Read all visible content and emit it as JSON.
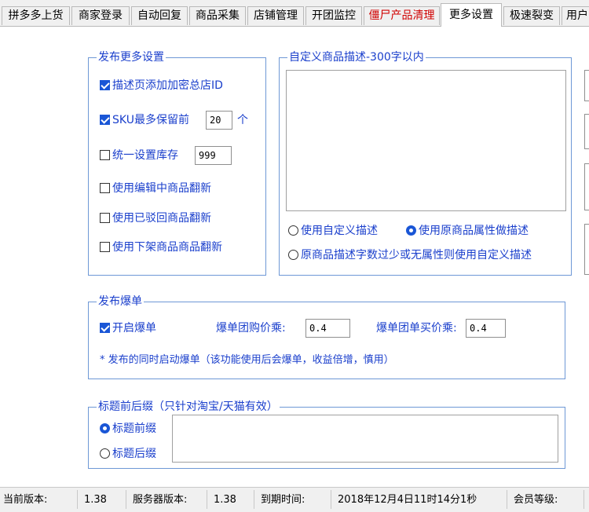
{
  "tabs": [
    {
      "label": "拼多多上货"
    },
    {
      "label": "商家登录"
    },
    {
      "label": "自动回复"
    },
    {
      "label": "商品采集"
    },
    {
      "label": "店铺管理"
    },
    {
      "label": "开团监控"
    },
    {
      "label": "僵尸产品清理"
    },
    {
      "label": "更多设置"
    },
    {
      "label": "极速裂变"
    },
    {
      "label": "用户"
    }
  ],
  "publish_settings": {
    "title": "发布更多设置",
    "encrypt_shop_id": {
      "label": "描述页添加加密总店ID",
      "checked": true
    },
    "sku_keep": {
      "label": "SKU最多保留前",
      "value": "20",
      "unit": "个",
      "checked": true
    },
    "unified_stock": {
      "label": "统一设置库存",
      "value": "999",
      "checked": false
    },
    "use_editing": {
      "label": "使用编辑中商品翻新",
      "checked": false
    },
    "use_rejected": {
      "label": "使用已驳回商品翻新",
      "checked": false
    },
    "use_offshelf": {
      "label": "使用下架商品商品翻新",
      "checked": false
    }
  },
  "custom_desc": {
    "title": "自定义商品描述-300字以内",
    "text": "",
    "option_custom": "使用自定义描述",
    "option_original": "使用原商品属性做描述",
    "option_fallback": "原商品描述字数过少或无属性则使用自定义描述",
    "selected": "original"
  },
  "hot_order": {
    "title": "发布爆单",
    "enable": {
      "label": "开启爆单",
      "checked": true
    },
    "group_mult": {
      "label": "爆单团购价乘:",
      "value": "0.4"
    },
    "single_mult": {
      "label": "爆单团单买价乘:",
      "value": "0.4"
    },
    "note": "* 发布的同时启动爆单（该功能使用后会爆单，收益倍增，慎用）"
  },
  "title_affix": {
    "title": "标题前后缀（只针对淘宝/天猫有效）",
    "prefix": "标题前缀",
    "suffix": "标题后缀",
    "selected": "prefix",
    "text": ""
  },
  "status": {
    "version_label": "当前版本:",
    "version": "1.38",
    "server_label": "服务器版本:",
    "server_version": "1.38",
    "expire_label": "到期时间:",
    "expire": "2018年12月4日11时14分1秒",
    "level_label": "会员等级:"
  }
}
